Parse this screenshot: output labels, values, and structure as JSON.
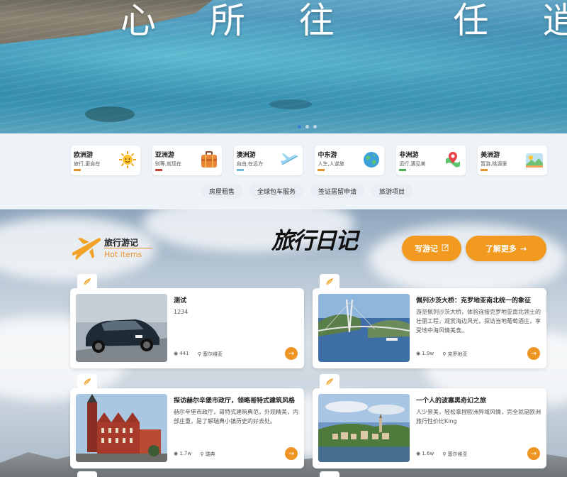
{
  "hero": {
    "title": "心 所 往   任 逍 遥",
    "slide_count": 3,
    "active_slide": 1
  },
  "categories": [
    {
      "title": "欧洲游",
      "subtitle": "旅行,更自在",
      "color": "#e8922a",
      "icon": "sun-icon"
    },
    {
      "title": "亚洲游",
      "subtitle": "别等,就现在",
      "color": "#c9433a",
      "icon": "suitcase-icon"
    },
    {
      "title": "澳洲游",
      "subtitle": "自由,在远方",
      "color": "#6fb7d6",
      "icon": "airplane-icon"
    },
    {
      "title": "中东游",
      "subtitle": "人生,入逆旅",
      "color": "#e8922a",
      "icon": "globe-icon"
    },
    {
      "title": "非洲游",
      "subtitle": "远行,遇见美",
      "color": "#4caf50",
      "icon": "map-pin-icon"
    },
    {
      "title": "美洲游",
      "subtitle": "暂游,桃源里",
      "color": "#e8922a",
      "icon": "landscape-icon"
    }
  ],
  "services": [
    "房屋租售",
    "全球包车服务",
    "签证居留申请",
    "旅游项目"
  ],
  "section": {
    "title": "旅行游记",
    "subtitle": "Hot items",
    "logo_text": "旅行日记",
    "write_label": "写游记",
    "more_label": "了解更多"
  },
  "cards": [
    {
      "title": "测试",
      "desc": "1234",
      "views": "441",
      "location": "塞尔维亚"
    },
    {
      "title": "佩列沙茨大桥：克罗地亚南北统一的象征",
      "desc": "游览佩列沙茨大桥，体验连接克罗地亚南北领土的壮丽工程，观赏海边风光，探访当地葡萄酒庄，享受地中海风情美食。",
      "views": "1.9w",
      "location": "克罗地亚"
    },
    {
      "title": "探访赫尔辛堡市政厅，领略哥特式建筑风格",
      "desc": "赫尔辛堡市政厅，哥特式建筑典范，外观精美，内部庄重，是了解瑞典小镇历史的好去处。",
      "views": "1.7w",
      "location": "瑞典"
    },
    {
      "title": "一个人的波塞黑奇幻之旅",
      "desc": "人少景美，轻松拿捏欧洲异域风情，完全就是欧洲旅行性价比King",
      "views": "1.6w",
      "location": "塞尔维亚"
    }
  ],
  "colors": {
    "accent": "#f19a1f",
    "accent_dark": "#ee9423"
  }
}
